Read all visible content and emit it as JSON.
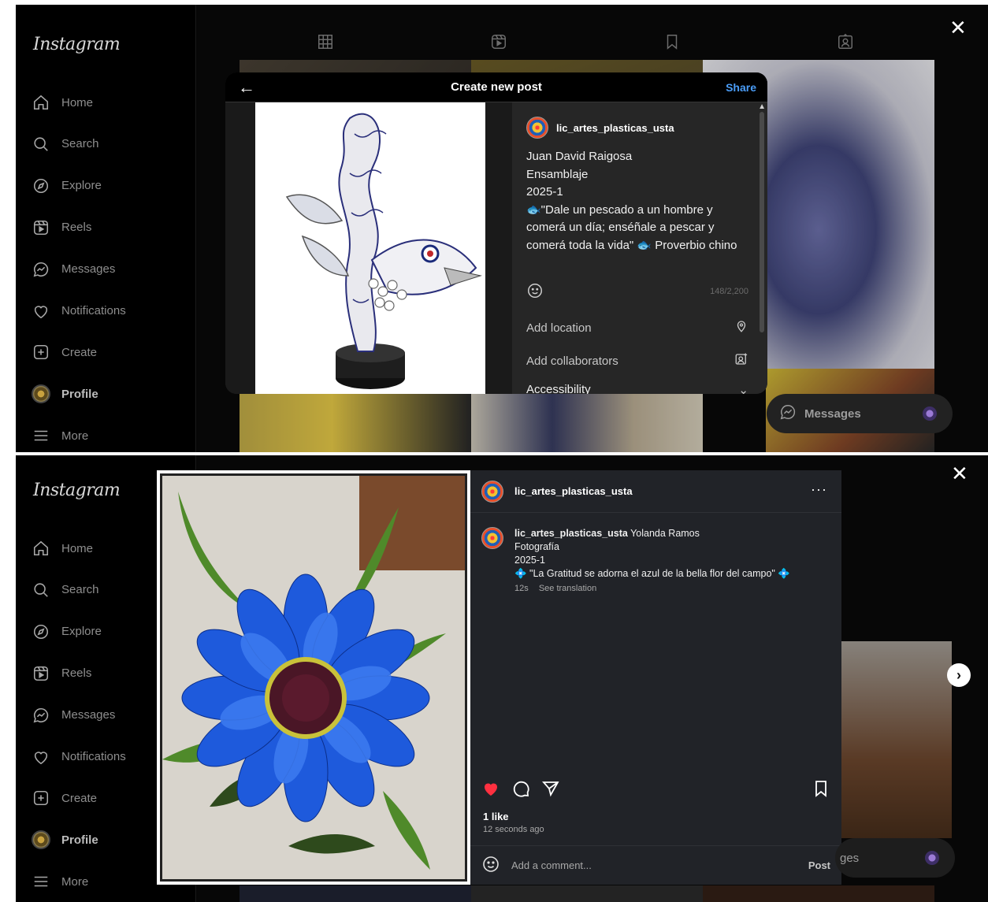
{
  "brand": "Instagram",
  "nav_items": [
    {
      "label": "Home",
      "icon": "home-icon"
    },
    {
      "label": "Search",
      "icon": "search-icon"
    },
    {
      "label": "Explore",
      "icon": "explore-icon"
    },
    {
      "label": "Reels",
      "icon": "reels-icon"
    },
    {
      "label": "Messages",
      "icon": "messages-icon"
    },
    {
      "label": "Notifications",
      "icon": "heart-icon"
    },
    {
      "label": "Create",
      "icon": "plus-icon"
    },
    {
      "label": "Profile",
      "icon": "avatar"
    },
    {
      "label": "More",
      "icon": "menu-icon"
    }
  ],
  "profile_tabs": [
    "grid-icon",
    "reels-icon",
    "bookmark-icon",
    "tagged-icon"
  ],
  "create_post": {
    "back_icon": "arrow-left-icon",
    "title": "Create new post",
    "share": "Share",
    "username": "lic_artes_plasticas_usta",
    "caption_lines": [
      "Juan David Raigosa",
      "Ensamblaje",
      "2025-1",
      "🐟\"Dale un pescado a un hombre y",
      "comerá un día; enséñale a pescar y",
      "comerá toda la vida\" 🐟 Proverbio chino"
    ],
    "char_count": "148/2,200",
    "add_location": "Add location",
    "add_collaborators": "Add collaborators",
    "accessibility": "Accessibility"
  },
  "messages_pill": "Messages",
  "messages_pill_partial": "ges",
  "post_view": {
    "username": "lic_artes_plasticas_usta",
    "more": "···",
    "caption_user": "lic_artes_plasticas_usta",
    "caption_first": "Yolanda Ramos",
    "caption_lines": [
      "Fotografía",
      "2025-1",
      "💠 \"La Gratitud se adorna el azul de la bella flor del campo\" 💠"
    ],
    "age": "12s",
    "see_translation": "See translation",
    "likes": "1 like",
    "time_ago": "12 seconds ago",
    "comment_placeholder": "Add a comment...",
    "post": "Post"
  },
  "colors": {
    "accent_blue": "#4a9cf6",
    "like_red": "#ff3040",
    "modal_bg": "#262626",
    "panel_bg": "#212328"
  }
}
